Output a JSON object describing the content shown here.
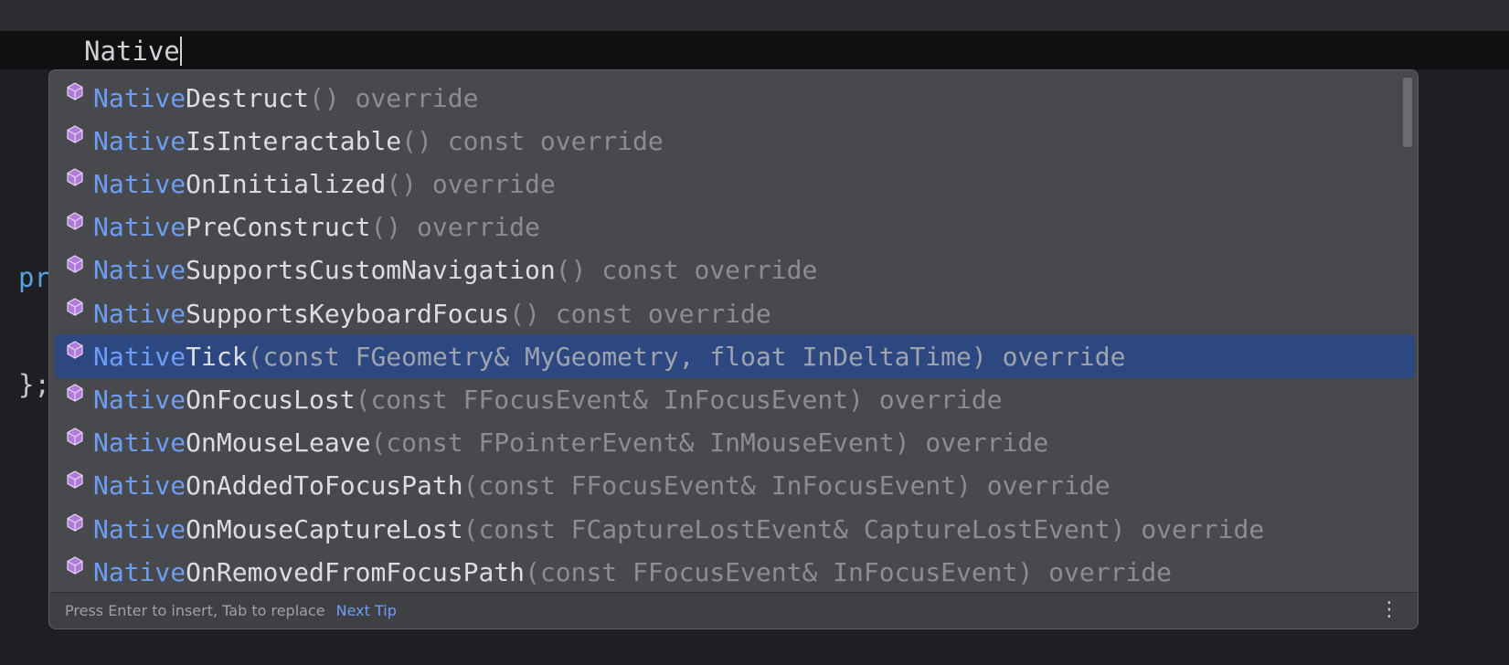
{
  "editor": {
    "typed_text": "Native",
    "background_code": [
      {
        "text": "pr"
      },
      {
        "text": "};"
      }
    ]
  },
  "completion": {
    "items": [
      {
        "prefix": "Native",
        "name": "Destruct",
        "signature": "() override",
        "selected": false
      },
      {
        "prefix": "Native",
        "name": "IsInteractable",
        "signature": "() const override",
        "selected": false
      },
      {
        "prefix": "Native",
        "name": "OnInitialized",
        "signature": "() override",
        "selected": false
      },
      {
        "prefix": "Native",
        "name": "PreConstruct",
        "signature": "() override",
        "selected": false
      },
      {
        "prefix": "Native",
        "name": "SupportsCustomNavigation",
        "signature": "() const override",
        "selected": false
      },
      {
        "prefix": "Native",
        "name": "SupportsKeyboardFocus",
        "signature": "() const override",
        "selected": false
      },
      {
        "prefix": "Native",
        "name": "Tick",
        "signature": "(const FGeometry& MyGeometry, float InDeltaTime) override",
        "selected": true
      },
      {
        "prefix": "Native",
        "name": "OnFocusLost",
        "signature": "(const FFocusEvent& InFocusEvent) override",
        "selected": false
      },
      {
        "prefix": "Native",
        "name": "OnMouseLeave",
        "signature": "(const FPointerEvent& InMouseEvent) override",
        "selected": false
      },
      {
        "prefix": "Native",
        "name": "OnAddedToFocusPath",
        "signature": "(const FFocusEvent& InFocusEvent) override",
        "selected": false
      },
      {
        "prefix": "Native",
        "name": "OnMouseCaptureLost",
        "signature": "(const FCaptureLostEvent& CaptureLostEvent) override",
        "selected": false
      },
      {
        "prefix": "Native",
        "name": "OnRemovedFromFocusPath",
        "signature": "(const FFocusEvent& InFocusEvent) override",
        "selected": false
      }
    ],
    "item_icon": "method-override-icon",
    "footer": {
      "hint": "Press Enter to insert, Tab to replace",
      "next_tip": "Next Tip",
      "more_icon": "vertical-ellipsis-icon"
    }
  },
  "colors": {
    "match_prefix": "#6e9df5",
    "selection": "#2d4880",
    "icon_purple": "#b07ad8"
  }
}
